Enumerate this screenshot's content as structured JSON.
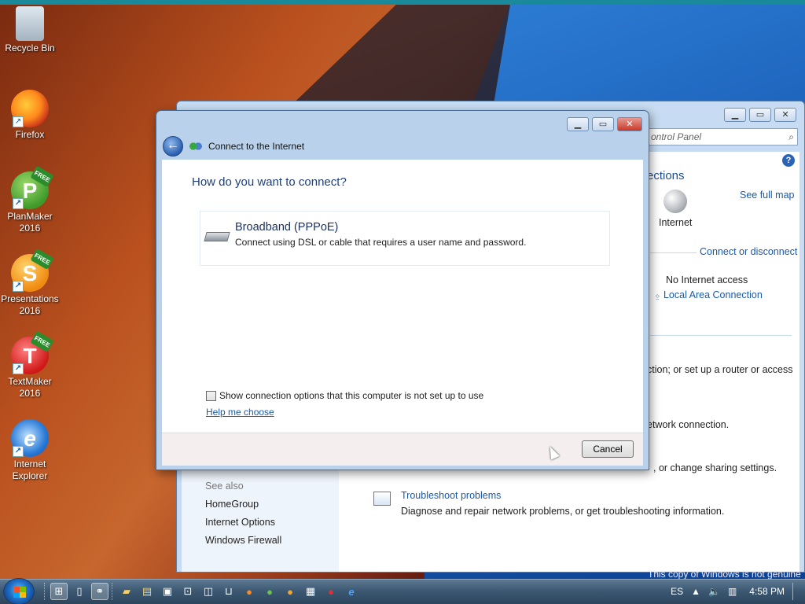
{
  "desktop": {
    "icons": [
      {
        "label": "Recycle Bin"
      },
      {
        "label": "Firefox"
      },
      {
        "label": "PlanMaker 2016"
      },
      {
        "label": "Presentations 2016"
      },
      {
        "label": "TextMaker 2016"
      },
      {
        "label": "Internet Explorer"
      }
    ],
    "free_badge": "FREE"
  },
  "control_panel": {
    "search_placeholder": "ontrol Panel",
    "heading_partial": "ections",
    "see_full_map": "See full map",
    "internet_label": "Internet",
    "connect_or_disconnect": "Connect or disconnect",
    "no_internet_access": "No Internet access",
    "local_area_connection": "Local Area Connection",
    "line1": "ction; or set up a router or access",
    "line2": "etwork connection.",
    "line3": ", or change sharing settings.",
    "troubleshoot_title": "Troubleshoot problems",
    "troubleshoot_desc": "Diagnose and repair network problems, or get troubleshooting information.",
    "see_also": "See also",
    "side_links": [
      "HomeGroup",
      "Internet Options",
      "Windows Firewall"
    ]
  },
  "dialog": {
    "title": "Connect to the Internet",
    "heading": "How do you want to connect?",
    "option_title": "Broadband (PPPoE)",
    "option_desc": "Connect using DSL or cable that requires a user name and password.",
    "checkbox_label": "Show connection options that this computer is not set up to use",
    "help_link": "Help me choose",
    "cancel": "Cancel"
  },
  "watermark": "This copy of Windows is not genuine",
  "taskbar": {
    "language": "ES",
    "time": "4:58 PM"
  }
}
